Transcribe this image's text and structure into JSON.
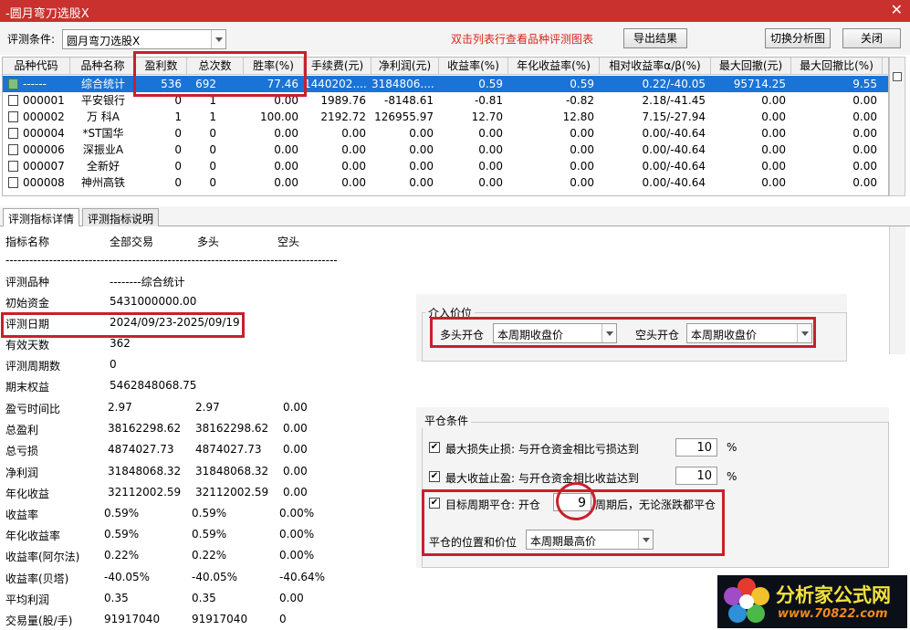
{
  "window": {
    "title": "-圆月弯刀选股X",
    "close_glyph": "✕"
  },
  "toolbar": {
    "condition_label": "评测条件:",
    "condition_value": "圆月弯刀选股X",
    "hint": "双击列表行查看品种评测图表",
    "export_label": "导出结果",
    "switch_label": "切换分析图",
    "close_label": "关闭"
  },
  "table": {
    "headers": [
      "品种代码",
      "品种名称",
      "盈利数",
      "总次数",
      "胜率(%)",
      "手续费(元)",
      "净利润(元)",
      "收益率(%)",
      "年化收益率(%)",
      "相对收益率α/β(%)",
      "最大回撤(元)",
      "最大回撤比(%)"
    ],
    "rows": [
      [
        "------",
        "综合统计",
        "536",
        "692",
        "77.46",
        "1440202....",
        "3184806....",
        "0.59",
        "0.59",
        "0.22/-40.05",
        "95714.25",
        "9.55"
      ],
      [
        "000001",
        "平安银行",
        "0",
        "1",
        "0.00",
        "1989.76",
        "-8148.61",
        "-0.81",
        "-0.82",
        "2.18/-41.45",
        "0.00",
        "0.00"
      ],
      [
        "000002",
        "万 科A",
        "1",
        "1",
        "100.00",
        "2192.72",
        "126955.97",
        "12.70",
        "12.80",
        "7.15/-27.94",
        "0.00",
        "0.00"
      ],
      [
        "000004",
        "*ST国华",
        "0",
        "0",
        "0.00",
        "0.00",
        "0.00",
        "0.00",
        "0.00",
        "0.00/-40.64",
        "0.00",
        "0.00"
      ],
      [
        "000006",
        "深振业A",
        "0",
        "0",
        "0.00",
        "0.00",
        "0.00",
        "0.00",
        "0.00",
        "0.00/-40.64",
        "0.00",
        "0.00"
      ],
      [
        "000007",
        "全新好",
        "0",
        "0",
        "0.00",
        "0.00",
        "0.00",
        "0.00",
        "0.00",
        "0.00/-40.64",
        "0.00",
        "0.00"
      ],
      [
        "000008",
        "神州高铁",
        "0",
        "0",
        "0.00",
        "0.00",
        "0.00",
        "0.00",
        "0.00",
        "0.00/-40.64",
        "0.00",
        "0.00"
      ]
    ]
  },
  "tabs": {
    "detail": "评测指标详情",
    "explain": "评测指标说明"
  },
  "detail": {
    "header": [
      "指标名称",
      "全部交易",
      "多头",
      "空头"
    ],
    "separator": "--------------------------------------------------------------------------------------------------",
    "single": [
      [
        "评测品种",
        "--------综合统计"
      ],
      [
        "初始资金",
        "5431000000.00"
      ],
      [
        "评测日期",
        "2024/09/23-2025/09/19"
      ],
      [
        "有效天数",
        "362"
      ],
      [
        "评测周期数",
        "0"
      ],
      [
        "期末权益",
        "5462848068.75"
      ]
    ],
    "triple": [
      [
        "盈亏时间比",
        "2.97",
        "2.97",
        "0.00"
      ],
      [
        "总盈利",
        "38162298.62",
        "38162298.62",
        "0.00"
      ],
      [
        "总亏损",
        "4874027.73",
        "4874027.73",
        "0.00"
      ],
      [
        "净利润",
        "31848068.32",
        "31848068.32",
        "0.00"
      ],
      [
        "年化收益",
        "32112002.59",
        "32112002.59",
        "0.00"
      ],
      [
        "收益率",
        "0.59%",
        "0.59%",
        "0.00%"
      ],
      [
        "年化收益率",
        "0.59%",
        "0.59%",
        "0.00%"
      ],
      [
        "收益率(阿尔法)",
        "0.22%",
        "0.22%",
        "0.00%"
      ],
      [
        "收益率(贝塔)",
        "-40.05%",
        "-40.05%",
        "-40.64%"
      ],
      [
        "平均利润",
        "0.35",
        "0.35",
        "0.00"
      ],
      [
        "交易量(股/手)",
        "91917040",
        "91917040",
        "0"
      ]
    ]
  },
  "entry": {
    "group_title": "介入价位",
    "long_label": "多头开仓",
    "long_value": "本周期收盘价",
    "short_label": "空头开仓",
    "short_value": "本周期收盘价"
  },
  "exit": {
    "group_title": "平仓条件",
    "stoploss_label": "最大损失止损: 与开仓资金相比亏损达到",
    "stoploss_value": "10",
    "takeprofit_label": "最大收益止盈: 与开仓资金相比收益达到",
    "takeprofit_value": "10",
    "percent": "%",
    "period_label_pre": "目标周期平仓: 开仓",
    "period_value": "9",
    "period_label_post": "周期后，无论涨跌都平仓",
    "position_label": "平仓的位置和价位",
    "position_value": "本周期最高价",
    "check_glyph": "✔"
  },
  "watermark": {
    "name": "分析家公式网",
    "url": "www.70822.com"
  }
}
